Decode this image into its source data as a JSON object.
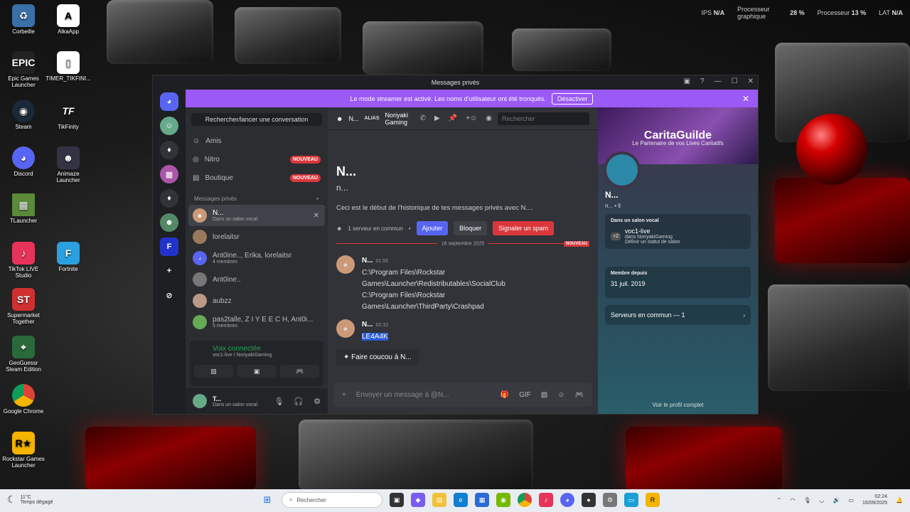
{
  "system_overlay": {
    "ips_label": "IPS",
    "ips_value": "N/A",
    "cpu_graph_label": "Processeur graphique",
    "gpu_value": "28 %",
    "cpu_label": "Processeur",
    "cpu_value": "13 %",
    "lat_label": "LAT",
    "lat_value": "N/A"
  },
  "desktop_icons": [
    {
      "label": "Corbeille",
      "icon": "recycle-bin-icon"
    },
    {
      "label": "AlkaApp",
      "icon": "alka-icon"
    },
    {
      "label": "Epic Games Launcher",
      "icon": "epic-icon"
    },
    {
      "label": "TIMER_TIKFINI...",
      "icon": "file-icon"
    },
    {
      "label": "Steam",
      "icon": "steam-icon"
    },
    {
      "label": "TikFinity",
      "icon": "tikfinity-icon"
    },
    {
      "label": "Discord",
      "icon": "discord-icon"
    },
    {
      "label": "Animaze Launcher",
      "icon": "animaze-icon"
    },
    {
      "label": "TLauncher",
      "icon": "minecraft-icon"
    },
    {
      "label": "TikTok LIVE Studio",
      "icon": "tiktok-icon"
    },
    {
      "label": "Fortnite",
      "icon": "fortnite-icon"
    },
    {
      "label": "Supermarket Together",
      "icon": "supermarket-icon"
    },
    {
      "label": "GeoGuessr Steam Edition",
      "icon": "geoguessr-icon"
    },
    {
      "label": "Google Chrome",
      "icon": "chrome-icon"
    },
    {
      "label": "Rockstar Games Launcher",
      "icon": "rockstar-icon"
    }
  ],
  "window": {
    "title": "Messages privés",
    "streamer_banner": "Le mode streamer est activé. Les noms d'utilisateur ont été tronqués.",
    "streamer_button": "Désactiver"
  },
  "dm_sidebar": {
    "search": "Rechercher/lancer une conversation",
    "nav": [
      {
        "label": "Amis",
        "icon": "friends-icon",
        "badge": ""
      },
      {
        "label": "Nitro",
        "icon": "nitro-icon",
        "badge": "NOUVEAU"
      },
      {
        "label": "Boutique",
        "icon": "shop-icon",
        "badge": "NOUVEAU"
      }
    ],
    "section_title": "Messages privés",
    "dms": [
      {
        "name": "N...",
        "sub": "Dans un salon vocal",
        "active": true
      },
      {
        "name": "lorelaitsr",
        "sub": ""
      },
      {
        "name": "Ant0ine.., Erika, lorelaitsr",
        "sub": "4 membres"
      },
      {
        "name": "Ant0ine..",
        "sub": ""
      },
      {
        "name": "aubzz",
        "sub": ""
      },
      {
        "name": "pas2talle, Z I Y E E C H, Ant0i...",
        "sub": "5 membres"
      }
    ],
    "voice": {
      "status": "Voix connectée",
      "channel": "voc1-live / NoriyakiGaming"
    },
    "user": {
      "name": "T...",
      "status": "Dans un salon vocal"
    }
  },
  "chat": {
    "header_name": "N...",
    "alias_label": "ALIAS",
    "alias_value": "Noriyaki Gaming",
    "search_placeholder": "Rechercher",
    "big_name": "N...",
    "small_name": "n...",
    "beginning": "Ceci est le début de l'historique de tes messages privés avec N....",
    "common_servers": "1 serveur en commun",
    "btn_add": "Ajouter",
    "btn_block": "Bloquer",
    "btn_spam": "Signaler un spam",
    "date_divider": "16 septembre 2025",
    "new_label": "NOUVEAU",
    "messages": [
      {
        "author": "N...",
        "time": "01:55",
        "lines": [
          "C:\\Program Files\\Rockstar",
          "Games\\Launcher\\Redistributables\\SocialClub",
          "C:\\Program Files\\Rockstar",
          "Games\\Launcher\\ThirdParty\\Crashpad"
        ]
      },
      {
        "author": "N...",
        "time": "02:10",
        "lines": [
          "LE4A4K"
        ]
      }
    ],
    "wave": "Faire coucou à N...",
    "composer_placeholder": "Envoyer un message à @N..."
  },
  "profile": {
    "banner_title": "CaritaGuilde",
    "banner_sub": "Le Partenaire de vos Lives Caritatifs",
    "name": "N...",
    "sub": "n... • ll",
    "voice_title": "Dans un salon vocal",
    "voice_channel": "voc1-live",
    "voice_server": "dans NoriyakiGaming",
    "voice_count": "+2",
    "voice_status": "Définir un statut de salon",
    "member_since_label": "Membre depuis",
    "member_since": "31 juil. 2019",
    "common_servers": "Serveurs en commun — 1",
    "see_full": "Voir le profil complet"
  },
  "taskbar": {
    "temp": "11°C",
    "weather": "Temps dégagé",
    "search": "Rechercher",
    "time": "02:24",
    "date": "16/09/2025"
  },
  "colors": {
    "discord_blurple": "#5865f2",
    "streamer_purple": "#9b59f5",
    "danger": "#da373c",
    "online": "#23a55a"
  }
}
